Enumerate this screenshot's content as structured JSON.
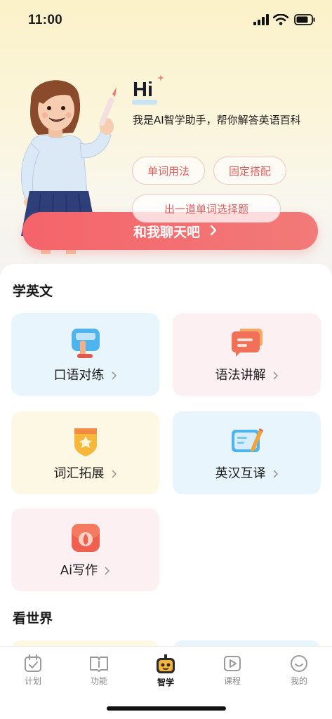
{
  "status_bar": {
    "time": "11:00"
  },
  "assistant": {
    "greeting": "Hi",
    "intro": "我是AI智学助手，帮你解答英语百科",
    "chips": [
      "单词用法",
      "固定搭配",
      "出一道单词选择题"
    ],
    "chat_button": "和我聊天吧"
  },
  "learn_english": {
    "title": "学英文",
    "cards": [
      {
        "label": "口语对练",
        "icon": "speaking-practice-icon"
      },
      {
        "label": "语法讲解",
        "icon": "grammar-chat-icon"
      },
      {
        "label": "词汇拓展",
        "icon": "vocabulary-badge-icon"
      },
      {
        "label": "英汉互译",
        "icon": "translate-card-icon"
      },
      {
        "label": "Ai写作",
        "icon": "ai-writing-icon"
      }
    ]
  },
  "see_world": {
    "title": "看世界"
  },
  "tabbar": {
    "tabs": [
      {
        "label": "计划",
        "icon": "calendar-check-icon"
      },
      {
        "label": "功能",
        "icon": "book-info-icon"
      },
      {
        "label": "智学",
        "icon": "robot-icon"
      },
      {
        "label": "课程",
        "icon": "play-video-icon"
      },
      {
        "label": "我的",
        "icon": "smiley-profile-icon"
      }
    ],
    "active": "智学"
  },
  "colors": {
    "accent_red": "#f4646a",
    "chip_text": "#e05b5b",
    "card_blue": "#e8f5fd",
    "card_pink": "#fdf0f3",
    "card_yellow": "#fdf8e3"
  }
}
